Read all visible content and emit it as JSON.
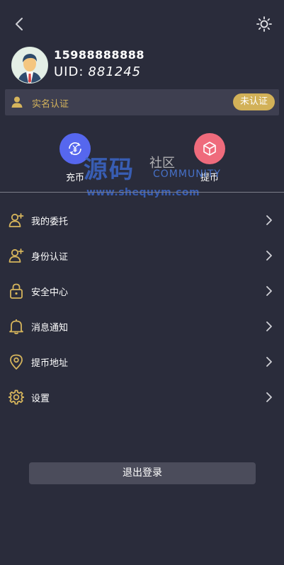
{
  "profile": {
    "phone": "15988888888",
    "uid_label": "UID:",
    "uid_value": "881245"
  },
  "kyc": {
    "label": "实名认证",
    "status": "未认证"
  },
  "quick_actions": {
    "deposit_label": "充币",
    "withdraw_label": "提币"
  },
  "watermark": {
    "main": "源码",
    "sub": "社区",
    "community": "COMMUNITY",
    "url": "www.shequym.com"
  },
  "menu": {
    "items": [
      {
        "label": "我的委托",
        "icon": "user-add-icon"
      },
      {
        "label": "身份认证",
        "icon": "user-add-icon"
      },
      {
        "label": "安全中心",
        "icon": "lock-icon"
      },
      {
        "label": "消息通知",
        "icon": "bell-icon"
      },
      {
        "label": "提币地址",
        "icon": "location-pin-icon"
      },
      {
        "label": "设置",
        "icon": "gear-icon"
      }
    ]
  },
  "logout_label": "退出登录",
  "colors": {
    "background": "#2a2c3b",
    "accent_gold": "#d2b158",
    "deposit_blue": "#5667ee",
    "withdraw_pink": "#ef6b7c",
    "panel": "#3e3f50"
  }
}
